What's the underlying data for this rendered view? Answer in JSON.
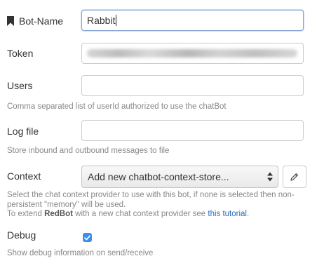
{
  "bot_name": {
    "label": "Bot-Name",
    "value": "Rabbit"
  },
  "token": {
    "label": "Token"
  },
  "users": {
    "label": "Users",
    "value": "",
    "help": "Comma separated list of userId authorized to use the chatBot"
  },
  "log_file": {
    "label": "Log file",
    "value": "",
    "help": "Store inbound and outbound messages to file"
  },
  "context": {
    "label": "Context",
    "selected": "Add new chatbot-context-store...",
    "help_line1": "Select the chat context provider to use with this bot, if none is selected then non-",
    "help_line2": "persistent \"memory\" will be used.",
    "help_line3_prefix": "To extend ",
    "help_line3_brand": "RedBot",
    "help_line3_middle": " with a new chat context provider see ",
    "help_line3_link": "this tutorial",
    "help_line3_suffix": "."
  },
  "debug": {
    "label": "Debug",
    "checked": true,
    "help": "Show debug information on send/receive"
  },
  "colors": {
    "focus_border": "#85a7d6",
    "checkbox": "#3b8ef0",
    "link": "#2a6fbf"
  },
  "icons": {
    "bot_name": "bookmark-icon",
    "edit": "pencil-icon",
    "select": "chevron-updown-icon",
    "checkbox": "checkmark-icon"
  }
}
